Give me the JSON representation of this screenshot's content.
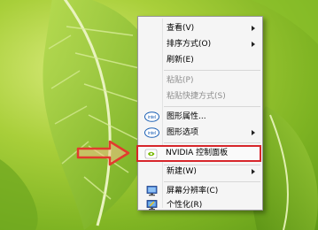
{
  "menu": {
    "items": [
      {
        "label": "查看(V)",
        "submenu": true
      },
      {
        "label": "排序方式(O)",
        "submenu": true
      },
      {
        "label": "刷新(E)"
      },
      {
        "label": "粘贴(P)",
        "disabled": true
      },
      {
        "label": "粘贴快捷方式(S)",
        "disabled": true
      },
      {
        "label": "图形属性...",
        "icon": "intel-graphics-icon"
      },
      {
        "label": "图形选项",
        "icon": "intel-graphics-icon",
        "submenu": true
      },
      {
        "label": "NVIDIA 控制面板",
        "icon": "nvidia-icon",
        "highlighted": true
      },
      {
        "label": "新建(W)",
        "submenu": true
      },
      {
        "label": "屏幕分辨率(C)",
        "icon": "display-icon"
      },
      {
        "label": "个性化(R)",
        "icon": "personalize-icon"
      }
    ]
  },
  "intel_badge": "intel",
  "colors": {
    "highlight_border": "#d7262b",
    "arrow": "#e23b2e",
    "nvidia_green": "#76b900"
  }
}
